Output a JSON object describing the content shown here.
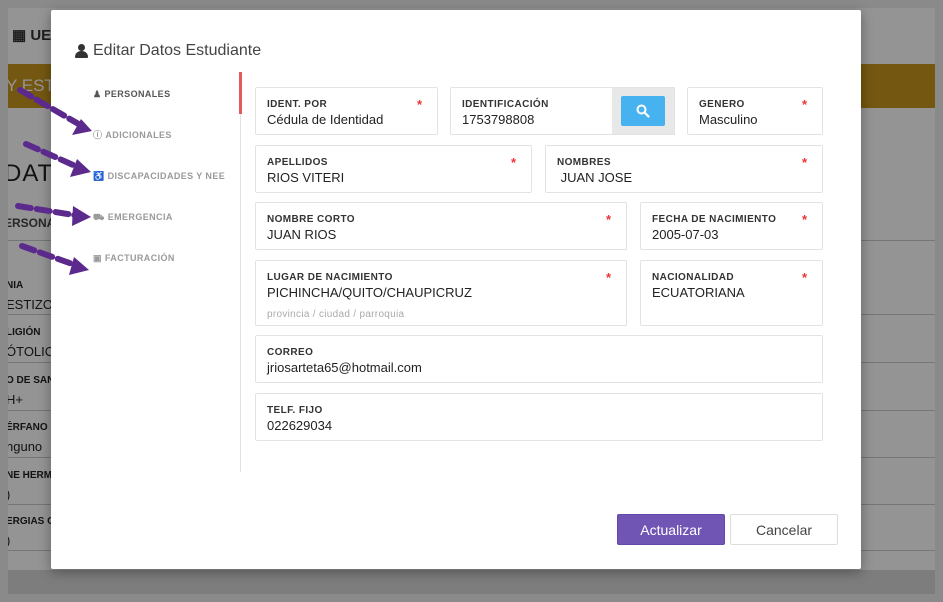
{
  "background": {
    "logo": "UE",
    "banner_text": "Y ESTU",
    "title": "DATOS",
    "section": "ERSONA",
    "fields": [
      {
        "label": "NIA",
        "value": "ESTIZO"
      },
      {
        "label": "LIGIÓN",
        "value": "ÓTOLICA"
      },
      {
        "label": "O DE SAN",
        "value": "H+"
      },
      {
        "label": "ÉRFANO",
        "value": "nguno"
      },
      {
        "label": "NE HERM",
        "value": ")"
      },
      {
        "label": "ERGIAS O",
        "value": ")"
      }
    ]
  },
  "modal": {
    "title": "Editar Datos Estudiante",
    "tabs": [
      {
        "label": "PERSONALES",
        "icon": "person-icon",
        "active": true
      },
      {
        "label": "ADICIONALES",
        "icon": "info-icon",
        "active": false
      },
      {
        "label": "DISCAPACIDADES Y NEE",
        "icon": "wheelchair-icon",
        "active": false
      },
      {
        "label": "EMERGENCIA",
        "icon": "ambulance-icon",
        "active": false
      },
      {
        "label": "FACTURACIÓN",
        "icon": "money-icon",
        "active": false
      }
    ],
    "form": {
      "ident_por": {
        "label": "IDENT. POR",
        "value": "Cédula de Identidad"
      },
      "identificacion": {
        "label": "IDENTIFICACIÓN",
        "value": "1753798808"
      },
      "genero": {
        "label": "GENERO",
        "value": "Masculino"
      },
      "apellidos": {
        "label": "APELLIDOS",
        "value": "RIOS VITERI"
      },
      "nombres": {
        "label": "NOMBRES",
        "value": " JUAN JOSE"
      },
      "nombre_corto": {
        "label": "NOMBRE CORTO",
        "value": "JUAN RIOS"
      },
      "fecha_nacimiento": {
        "label": "FECHA DE NACIMIENTO",
        "value": "2005-07-03"
      },
      "lugar_nacimiento": {
        "label": "LUGAR DE NACIMIENTO",
        "value": "PICHINCHA/QUITO/CHAUPICRUZ",
        "hint": "provincia / ciudad / parroquia"
      },
      "nacionalidad": {
        "label": "NACIONALIDAD",
        "value": "ECUATORIANA"
      },
      "correo": {
        "label": "CORREO",
        "value": "jriosarteta65@hotmail.com"
      },
      "telf_fijo": {
        "label": "TELF. FIJO",
        "value": "022629034"
      }
    },
    "required_mark": "*",
    "buttons": {
      "update": "Actualizar",
      "cancel": "Cancelar"
    }
  },
  "colors": {
    "accent": "#7055b5",
    "search_button": "#46b2f0",
    "required": "#ee3333",
    "banner": "#c8961c",
    "annotation_arrow": "#5b2a8c"
  }
}
